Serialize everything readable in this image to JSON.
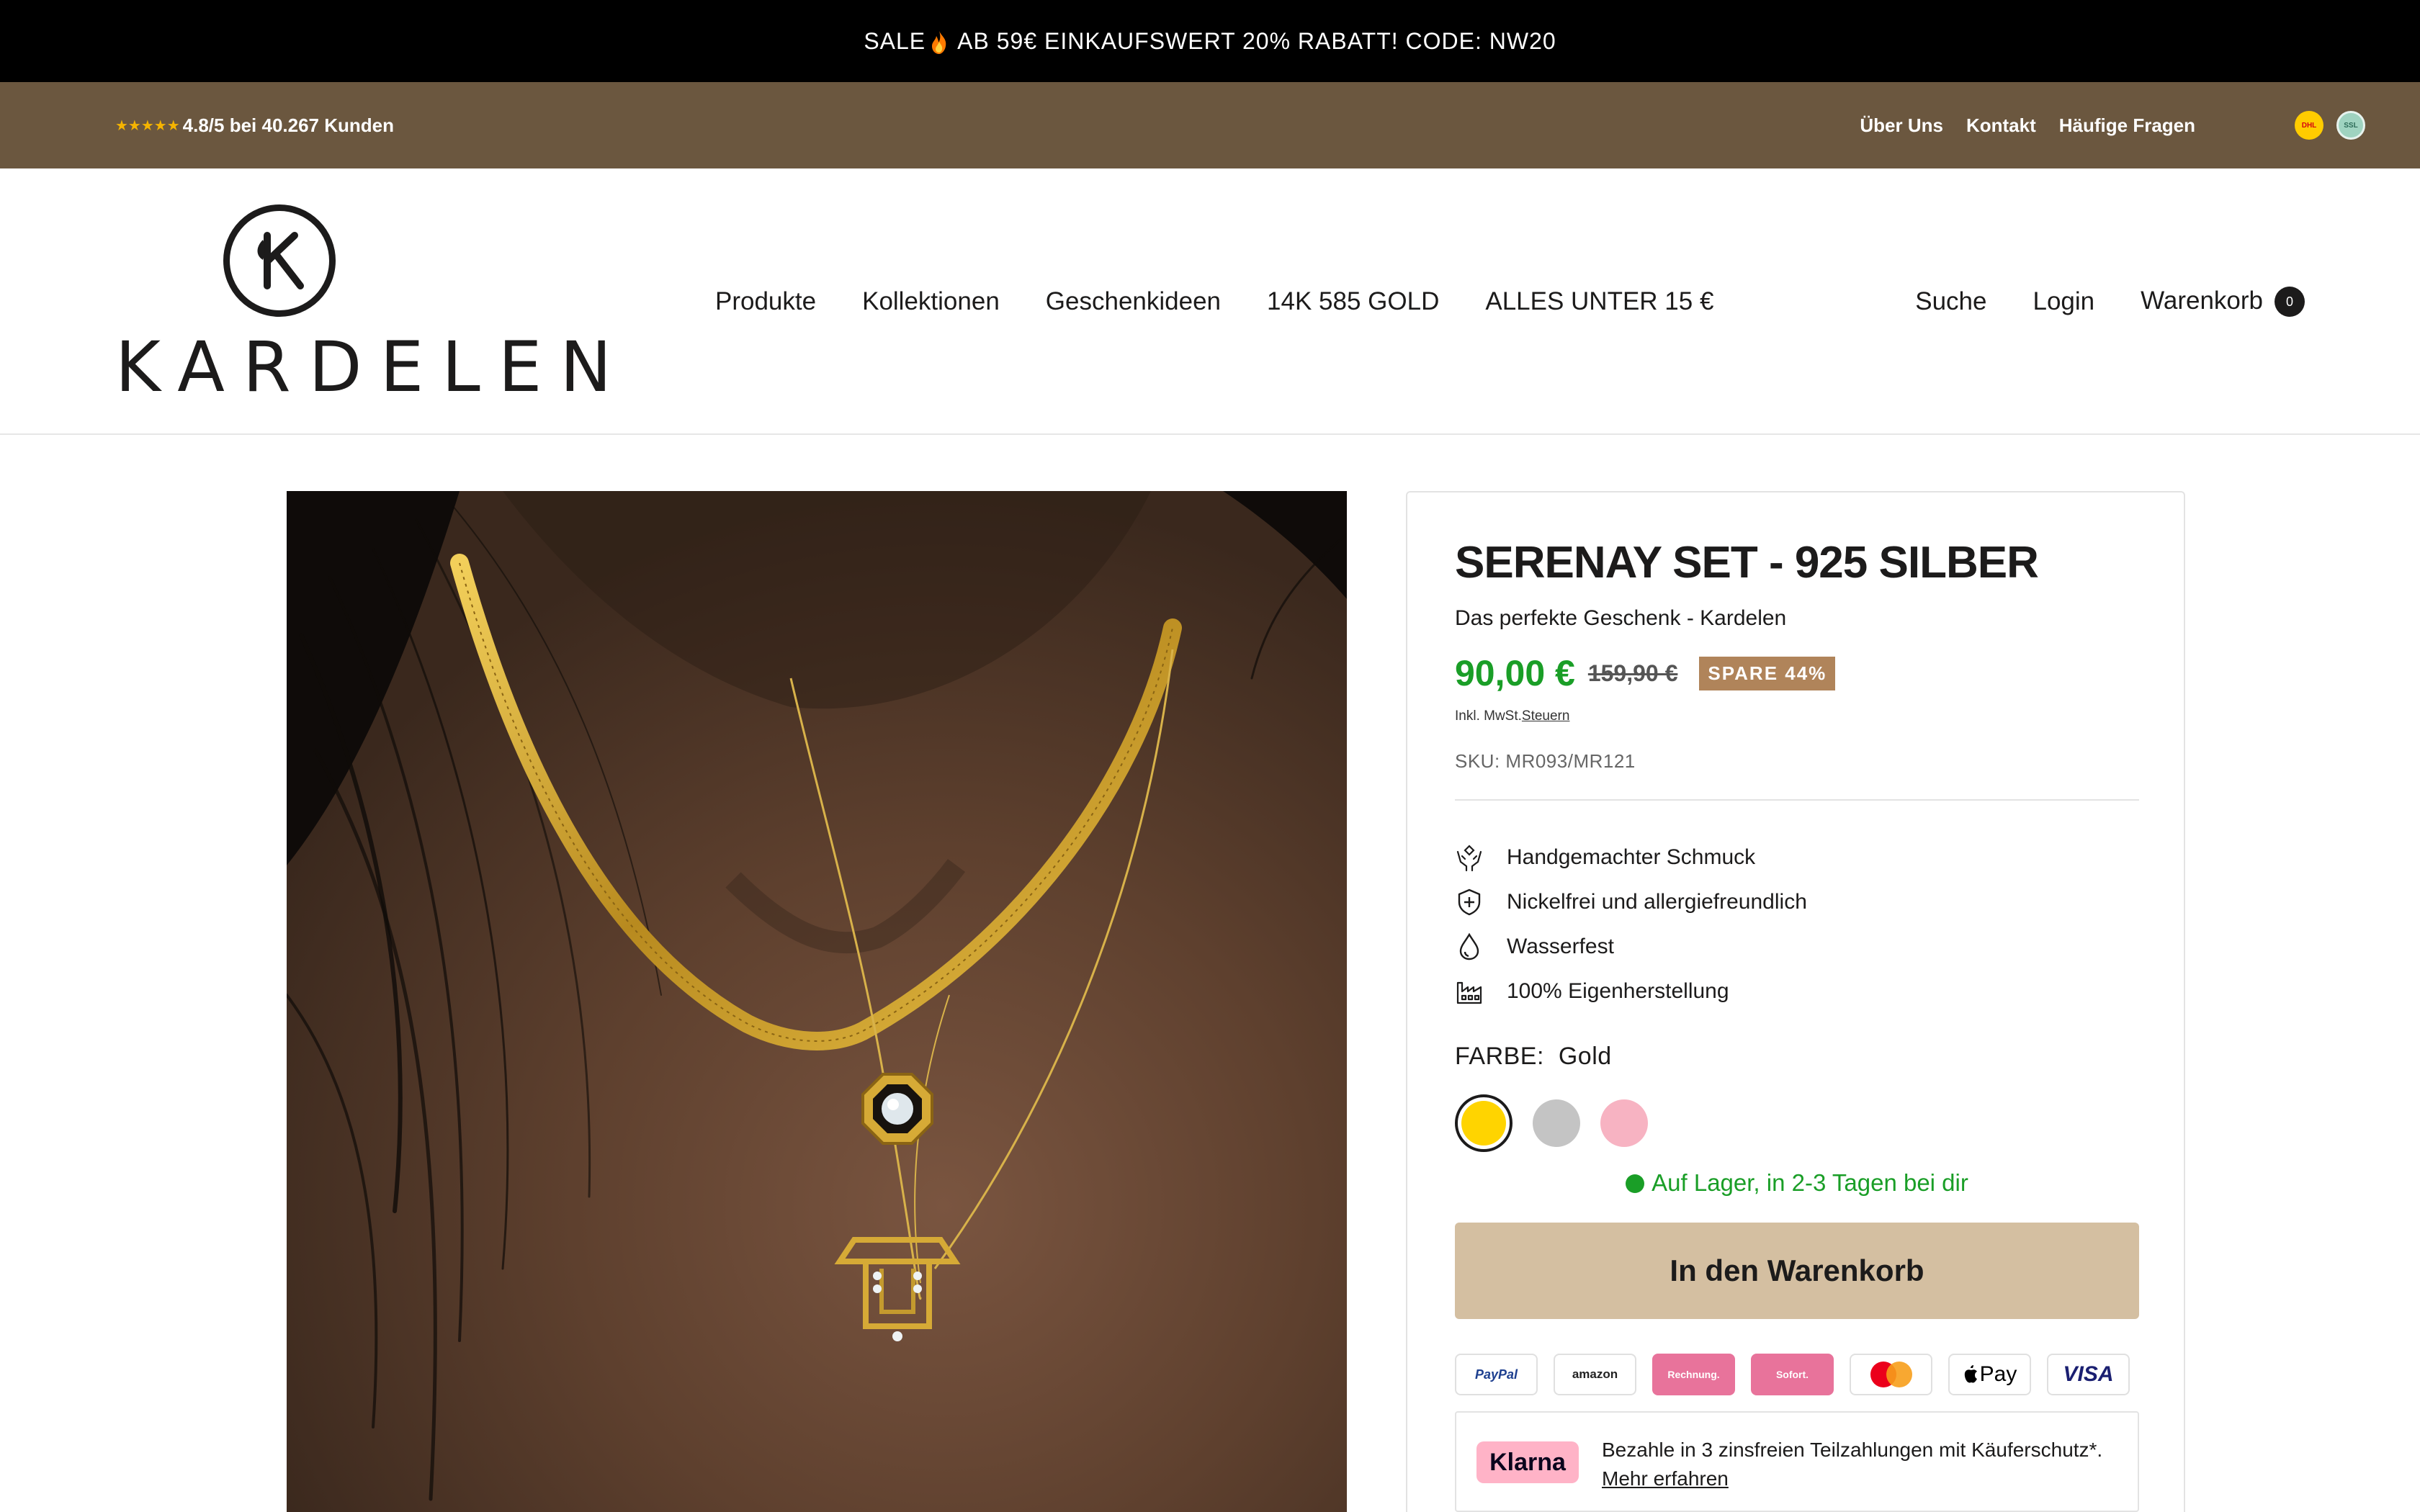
{
  "announcement": {
    "text_before": "SALE",
    "text_after": "AB 59€ EINKAUFSWERT 20% RABATT! CODE: NW20",
    "icon": "flame-icon"
  },
  "topbar": {
    "stars": "★★★★★",
    "rating_text": "4.8/5 bei 40.267 Kunden",
    "links": [
      "Über Uns",
      "Kontakt",
      "Häufige Fragen"
    ],
    "badges": [
      "DHL",
      "SSL"
    ]
  },
  "header": {
    "logo_text": "KARDELEN",
    "nav": [
      "Produkte",
      "Kollektionen",
      "Geschenkideen",
      "14K 585 GOLD",
      "ALLES UNTER 15 €"
    ],
    "search": "Suche",
    "login": "Login",
    "cart": "Warenkorb",
    "cart_count": "0"
  },
  "product": {
    "title": "SERENAY SET - 925 SILBER",
    "subtitle": "Das perfekte Geschenk - Kardelen",
    "price": "90,00 €",
    "old_price": "159,90 €",
    "save_badge": "SPARE 44%",
    "tax_prefix": "Inkl. MwSt.",
    "tax_link": "Steuern",
    "sku": "SKU: MR093/MR121",
    "features": [
      {
        "icon": "hands-icon",
        "text": "Handgemachter Schmuck"
      },
      {
        "icon": "shield-plus-icon",
        "text": "Nickelfrei und allergiefreundlich"
      },
      {
        "icon": "water-drop-icon",
        "text": "Wasserfest"
      },
      {
        "icon": "factory-icon",
        "text": "100% Eigenherstellung"
      }
    ],
    "color_label": "FARBE:",
    "color_value": "Gold",
    "swatches": [
      {
        "name": "Gold",
        "color": "#ffd400",
        "selected": true
      },
      {
        "name": "Silber",
        "color": "#c4c4c4",
        "selected": false
      },
      {
        "name": "Rosé",
        "color": "#f7b3c2",
        "selected": false
      }
    ],
    "stock": "Auf Lager, in 2-3 Tagen bei dir",
    "add_to_cart": "In den Warenkorb",
    "payments": [
      "PayPal",
      "amazon",
      "Rechnung.",
      "Sofort.",
      "MasterCard",
      "Pay",
      "VISA"
    ],
    "klarna_badge": "Klarna",
    "klarna_text": "Bezahle in 3 zinsfreien Teilzahlungen mit Käuferschutz*.",
    "klarna_link": "Mehr erfahren"
  },
  "colors": {
    "price_green": "#1a9e27",
    "cta": "#d4bfa1",
    "topbar": "#6b573f",
    "save_badge": "#b0845a"
  }
}
